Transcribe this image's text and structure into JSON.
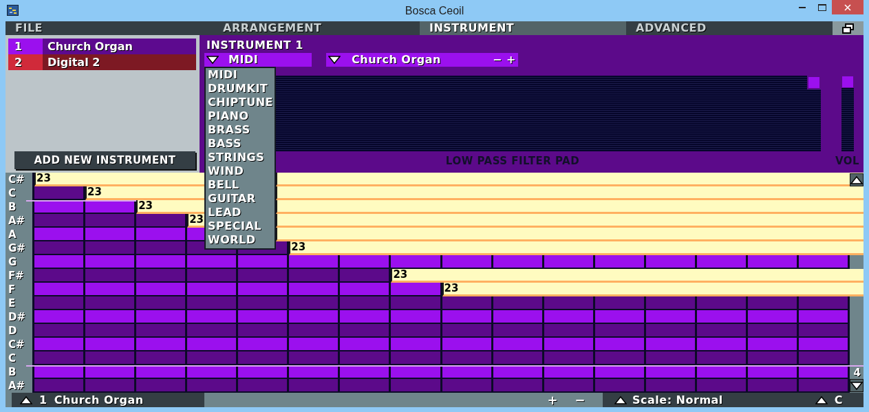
{
  "window": {
    "title": "Bosca Ceoil"
  },
  "menu_tabs": [
    {
      "label": "FILE",
      "selected": false
    },
    {
      "label": "ARRANGEMENT",
      "selected": false
    },
    {
      "label": "INSTRUMENT",
      "selected": true
    },
    {
      "label": "ADVANCED",
      "selected": false
    }
  ],
  "instruments": [
    {
      "number": "1",
      "name": "Church Organ",
      "color": "#9b10ee"
    },
    {
      "number": "2",
      "name": "Digital 2",
      "color": "#d02a3a"
    }
  ],
  "add_instrument_button": "ADD NEW INSTRUMENT",
  "instrument_editor": {
    "title": "INSTRUMENT 1",
    "category": {
      "value": "MIDI",
      "expanded": true
    },
    "category_options": [
      "MIDI",
      "DRUMKIT",
      "CHIPTUNE",
      "PIANO",
      "BRASS",
      "BASS",
      "STRINGS",
      "WIND",
      "BELL",
      "GUITAR",
      "LEAD",
      "SPECIAL",
      "WORLD"
    ],
    "voice": {
      "value": "Church Organ",
      "minus": "−",
      "plus": "+"
    },
    "filter_pad": {
      "label": "LOW PASS FILTER PAD",
      "cutoff": {
        "level": 1
      },
      "resonance": {
        "level": 0
      }
    },
    "volume": {
      "label": "VOL",
      "level": 1
    }
  },
  "piano_roll": {
    "octave": "4",
    "rows": [
      {
        "label": "C#",
        "octave_start": false,
        "steps": [
          {
            "kind": "note",
            "text": "23"
          }
        ]
      },
      {
        "label": "C",
        "octave_start": false,
        "steps": [
          {
            "kind": "rest"
          },
          {
            "kind": "note",
            "text": "23"
          }
        ]
      },
      {
        "label": "B",
        "octave_start": true,
        "steps": [
          {
            "kind": "rest"
          },
          {
            "kind": "rest"
          },
          {
            "kind": "note",
            "text": "23"
          }
        ]
      },
      {
        "label": "A#",
        "octave_start": false,
        "steps": [
          {
            "kind": "rest"
          },
          {
            "kind": "rest"
          },
          {
            "kind": "rest"
          },
          {
            "kind": "note",
            "text": "23"
          }
        ]
      },
      {
        "label": "A",
        "octave_start": false,
        "steps": [
          {
            "kind": "rest"
          },
          {
            "kind": "rest"
          },
          {
            "kind": "rest"
          },
          {
            "kind": "rest"
          },
          {
            "kind": "note"
          }
        ]
      },
      {
        "label": "G#",
        "octave_start": false,
        "steps": [
          {
            "kind": "rest"
          },
          {
            "kind": "rest"
          },
          {
            "kind": "rest"
          },
          {
            "kind": "rest"
          },
          {
            "kind": "rest"
          },
          {
            "kind": "note",
            "text": "23"
          }
        ]
      },
      {
        "label": "G",
        "octave_start": false,
        "steps": [
          {
            "kind": "rest"
          },
          {
            "kind": "rest"
          },
          {
            "kind": "rest"
          },
          {
            "kind": "rest"
          },
          {
            "kind": "rest"
          },
          {
            "kind": "rest"
          },
          {
            "kind": "rest"
          },
          {
            "kind": "rest"
          },
          {
            "kind": "rest"
          },
          {
            "kind": "rest"
          },
          {
            "kind": "rest"
          },
          {
            "kind": "rest"
          },
          {
            "kind": "rest"
          },
          {
            "kind": "rest"
          },
          {
            "kind": "rest"
          },
          {
            "kind": "rest"
          }
        ]
      },
      {
        "label": "F#",
        "octave_start": false,
        "steps": [
          {
            "kind": "rest"
          },
          {
            "kind": "rest"
          },
          {
            "kind": "rest"
          },
          {
            "kind": "rest"
          },
          {
            "kind": "rest"
          },
          {
            "kind": "rest"
          },
          {
            "kind": "rest"
          },
          {
            "kind": "note",
            "text": "23"
          }
        ]
      },
      {
        "label": "F",
        "octave_start": false,
        "steps": [
          {
            "kind": "rest"
          },
          {
            "kind": "rest"
          },
          {
            "kind": "rest"
          },
          {
            "kind": "rest"
          },
          {
            "kind": "rest"
          },
          {
            "kind": "rest"
          },
          {
            "kind": "rest"
          },
          {
            "kind": "rest"
          },
          {
            "kind": "note",
            "text": "23"
          }
        ]
      },
      {
        "label": "E",
        "octave_start": false,
        "steps": [
          {
            "kind": "rest"
          },
          {
            "kind": "rest"
          },
          {
            "kind": "rest"
          },
          {
            "kind": "rest"
          },
          {
            "kind": "rest"
          },
          {
            "kind": "rest"
          },
          {
            "kind": "rest"
          },
          {
            "kind": "rest"
          },
          {
            "kind": "rest"
          },
          {
            "kind": "rest"
          },
          {
            "kind": "rest"
          },
          {
            "kind": "rest"
          },
          {
            "kind": "rest"
          },
          {
            "kind": "rest"
          },
          {
            "kind": "rest"
          },
          {
            "kind": "rest"
          }
        ]
      },
      {
        "label": "D#",
        "octave_start": false,
        "steps": [
          {
            "kind": "rest"
          },
          {
            "kind": "rest"
          },
          {
            "kind": "rest"
          },
          {
            "kind": "rest"
          },
          {
            "kind": "rest"
          },
          {
            "kind": "rest"
          },
          {
            "kind": "rest"
          },
          {
            "kind": "rest"
          },
          {
            "kind": "rest"
          },
          {
            "kind": "rest"
          },
          {
            "kind": "rest"
          },
          {
            "kind": "rest"
          },
          {
            "kind": "rest"
          },
          {
            "kind": "rest"
          },
          {
            "kind": "rest"
          },
          {
            "kind": "rest"
          }
        ]
      },
      {
        "label": "D",
        "octave_start": false,
        "steps": [
          {
            "kind": "rest"
          },
          {
            "kind": "rest"
          },
          {
            "kind": "rest"
          },
          {
            "kind": "rest"
          },
          {
            "kind": "rest"
          },
          {
            "kind": "rest"
          },
          {
            "kind": "rest"
          },
          {
            "kind": "rest"
          },
          {
            "kind": "rest"
          },
          {
            "kind": "rest"
          },
          {
            "kind": "rest"
          },
          {
            "kind": "rest"
          },
          {
            "kind": "rest"
          },
          {
            "kind": "rest"
          },
          {
            "kind": "rest"
          },
          {
            "kind": "rest"
          }
        ]
      },
      {
        "label": "C#",
        "octave_start": false,
        "steps": [
          {
            "kind": "rest"
          },
          {
            "kind": "rest"
          },
          {
            "kind": "rest"
          },
          {
            "kind": "rest"
          },
          {
            "kind": "rest"
          },
          {
            "kind": "rest"
          },
          {
            "kind": "rest"
          },
          {
            "kind": "rest"
          },
          {
            "kind": "rest"
          },
          {
            "kind": "rest"
          },
          {
            "kind": "rest"
          },
          {
            "kind": "rest"
          },
          {
            "kind": "rest"
          },
          {
            "kind": "rest"
          },
          {
            "kind": "rest"
          },
          {
            "kind": "rest"
          }
        ]
      },
      {
        "label": "C",
        "octave_start": false,
        "steps": [
          {
            "kind": "rest"
          },
          {
            "kind": "rest"
          },
          {
            "kind": "rest"
          },
          {
            "kind": "rest"
          },
          {
            "kind": "rest"
          },
          {
            "kind": "rest"
          },
          {
            "kind": "rest"
          },
          {
            "kind": "rest"
          },
          {
            "kind": "rest"
          },
          {
            "kind": "rest"
          },
          {
            "kind": "rest"
          },
          {
            "kind": "rest"
          },
          {
            "kind": "rest"
          },
          {
            "kind": "rest"
          },
          {
            "kind": "rest"
          },
          {
            "kind": "rest"
          }
        ]
      },
      {
        "label": "B",
        "octave_start": true,
        "steps": [
          {
            "kind": "rest"
          },
          {
            "kind": "rest"
          },
          {
            "kind": "rest"
          },
          {
            "kind": "rest"
          },
          {
            "kind": "rest"
          },
          {
            "kind": "rest"
          },
          {
            "kind": "rest"
          },
          {
            "kind": "rest"
          },
          {
            "kind": "rest"
          },
          {
            "kind": "rest"
          },
          {
            "kind": "rest"
          },
          {
            "kind": "rest"
          },
          {
            "kind": "rest"
          },
          {
            "kind": "rest"
          },
          {
            "kind": "rest"
          },
          {
            "kind": "rest"
          }
        ]
      },
      {
        "label": "A#",
        "octave_start": false,
        "steps": [
          {
            "kind": "rest"
          },
          {
            "kind": "rest"
          },
          {
            "kind": "rest"
          },
          {
            "kind": "rest"
          },
          {
            "kind": "rest"
          },
          {
            "kind": "rest"
          },
          {
            "kind": "rest"
          },
          {
            "kind": "rest"
          },
          {
            "kind": "rest"
          },
          {
            "kind": "rest"
          },
          {
            "kind": "rest"
          },
          {
            "kind": "rest"
          },
          {
            "kind": "rest"
          },
          {
            "kind": "rest"
          },
          {
            "kind": "rest"
          },
          {
            "kind": "rest"
          }
        ]
      }
    ]
  },
  "footer": {
    "instrument_number": "1",
    "instrument_name": "Church Organ",
    "zoom_in": "+",
    "zoom_out": "−",
    "scale": "Scale: Normal",
    "key": "C"
  }
}
